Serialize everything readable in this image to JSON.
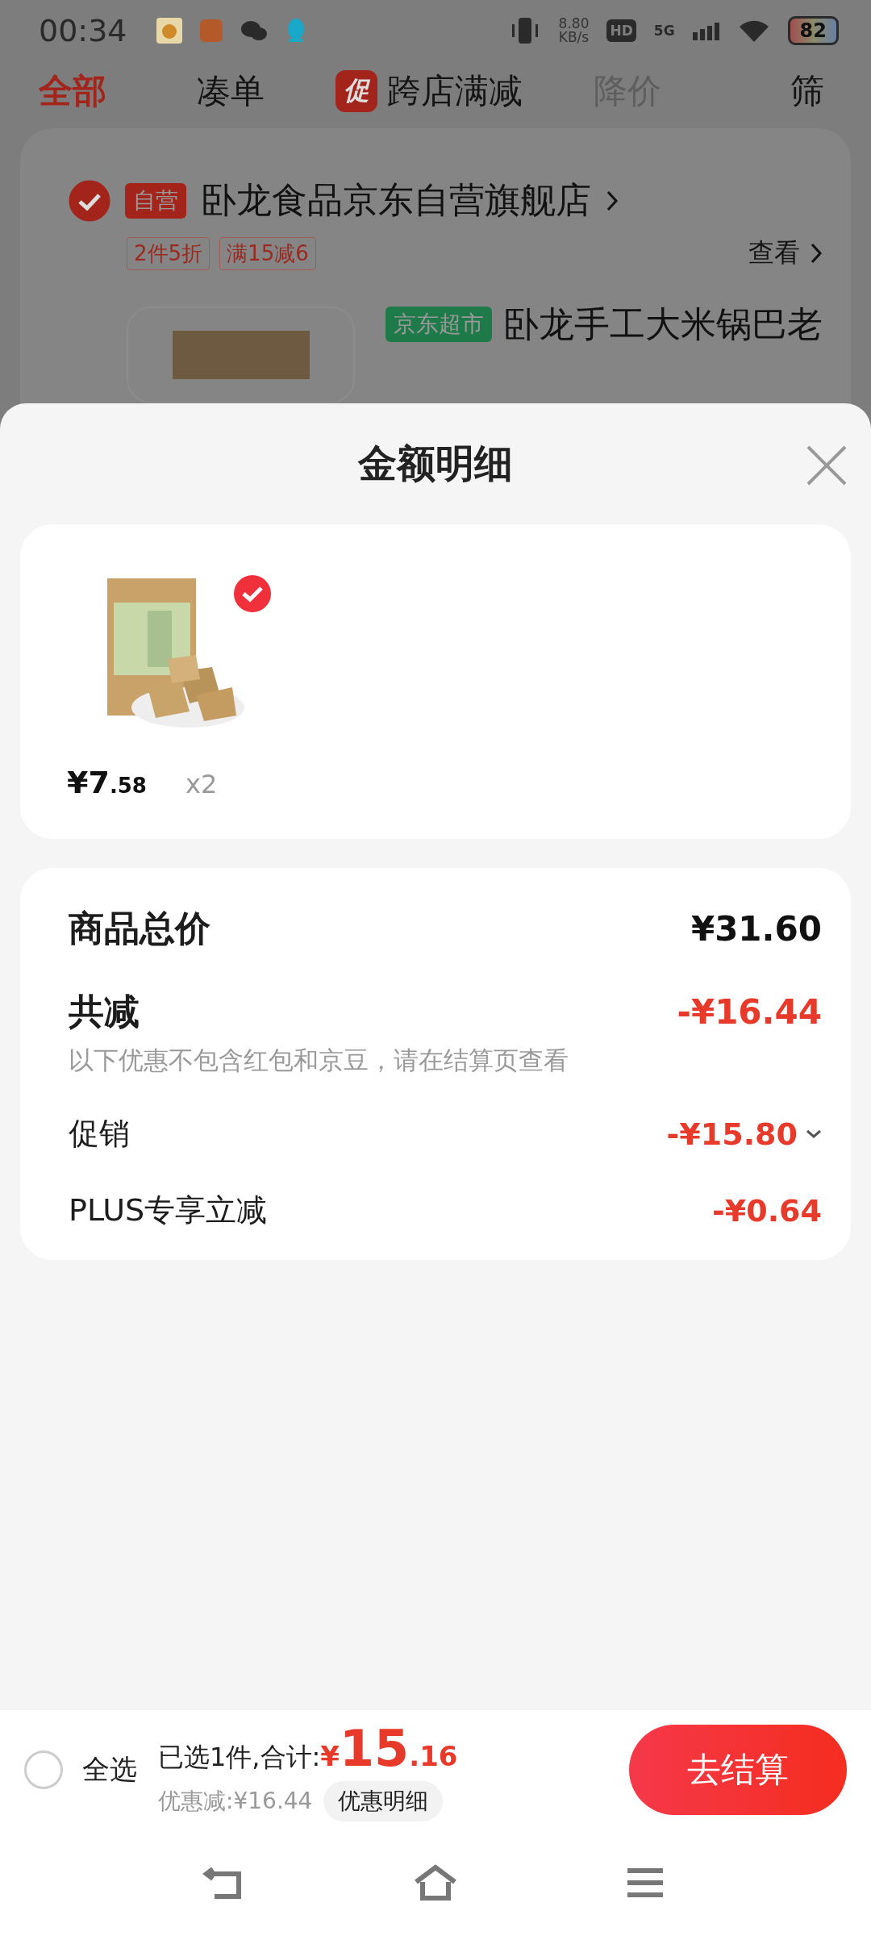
{
  "status_bar": {
    "time": "00:34",
    "speed_value": "8.80",
    "speed_unit": "KB/s",
    "hd": "HD",
    "network": "5G",
    "battery": "82"
  },
  "tabs": [
    {
      "label": "全部",
      "selected": true,
      "disabled": false
    },
    {
      "label": "凑单",
      "selected": false,
      "disabled": false
    },
    {
      "label": "跨店满减",
      "badge": "促",
      "selected": false,
      "disabled": false
    },
    {
      "label": "降价",
      "selected": false,
      "disabled": true
    },
    {
      "label": "筛",
      "selected": false,
      "disabled": false
    }
  ],
  "store": {
    "checked": true,
    "tag": "自营",
    "name": "卧龙食品京东自营旗舰店",
    "promos": [
      "2件5折",
      "满15减6"
    ],
    "view": "查看",
    "product_tag": "京东超市",
    "product_title": "卧龙手工大米锅巴老"
  },
  "sheet": {
    "title": "金额明细",
    "items": [
      {
        "kind": "picture",
        "checked": true,
        "price_main": "¥7",
        "price_decimal": ".58",
        "quantity": "x2"
      }
    ],
    "summary": [
      {
        "kind": "total",
        "label": "商品总价",
        "amount": "¥31.60"
      },
      {
        "kind": "discount",
        "label": "共减",
        "amount": "-¥16.44",
        "note": "以下优惠不包含红包和京豆，请在结算页查看"
      },
      {
        "kind": "line",
        "label": "促销",
        "amount": "-¥15.80",
        "expandable": true
      },
      {
        "kind": "line",
        "label": "PLUS专享立减",
        "amount": "-¥0.64",
        "expandable": false
      }
    ]
  },
  "checkout_bar": {
    "select_all": {
      "label": "全选",
      "checked": false
    },
    "selected_text": "已选1件,合计:",
    "currency": "¥",
    "total_main": "15",
    "total_decimal": ".16",
    "saved": "优惠减:¥16.44",
    "details": "优惠明细",
    "checkout": "去结算"
  }
}
